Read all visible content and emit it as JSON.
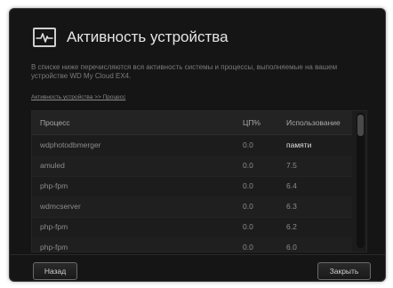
{
  "header": {
    "title": "Активность устройства",
    "icon": "activity-pulse-icon"
  },
  "description": "В списке ниже перечисляются вся активность системы и процессы, выполняемые на вашем устройстве WD My Cloud EX4.",
  "breadcrumb": "Активность устройства >> Процесс",
  "table": {
    "columns": [
      "Процесс",
      "ЦП%",
      "Использование",
      "памяти"
    ],
    "rows": [
      {
        "process": "wdphotodbmerger",
        "cpu": "0.0",
        "usage": ""
      },
      {
        "process": "amuled",
        "cpu": "0.0",
        "usage": "7.5"
      },
      {
        "process": "php-fpm",
        "cpu": "0.0",
        "usage": "6.4"
      },
      {
        "process": "wdmcserver",
        "cpu": "0.0",
        "usage": "6.3"
      },
      {
        "process": "php-fpm",
        "cpu": "0.0",
        "usage": "6.2"
      },
      {
        "process": "php-fpm",
        "cpu": "0.0",
        "usage": "6.0"
      }
    ]
  },
  "buttons": {
    "back": "Назад",
    "close": "Закрыть"
  }
}
